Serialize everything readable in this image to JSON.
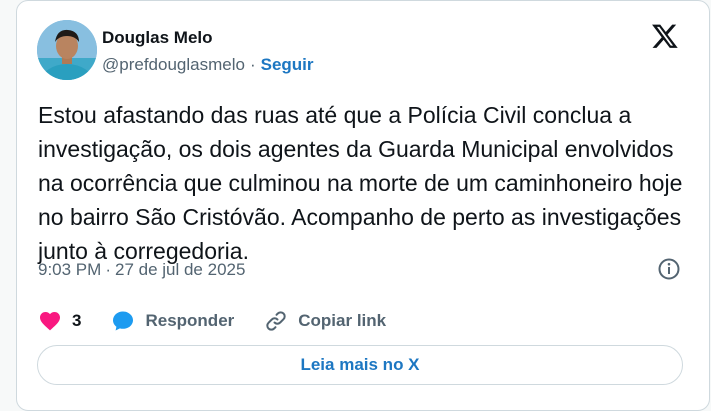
{
  "author": {
    "name": "Douglas Melo",
    "handle": "@prefdouglasmelo",
    "separator": "·",
    "follow_label": "Seguir"
  },
  "tweet": {
    "text": "Estou afastando das ruas até que a Polícia Civil conclua a investigação, os dois agentes da Guarda Municipal envolvidos na ocorrência que culminou na morte de um caminhoneiro hoje no bairro São Cristóvão. Acompanho de perto as investigações junto à corregedoria.",
    "time": "9:03 PM",
    "separator": "·",
    "date": "27 de jul de 2025"
  },
  "actions": {
    "like_count": "3",
    "reply_label": "Responder",
    "copy_label": "Copiar link"
  },
  "read_more_label": "Leia mais no X",
  "icons": {
    "logo": "x-logo-icon",
    "info": "info-icon",
    "like": "heart-icon",
    "reply": "speech-bubble-icon",
    "copy": "link-icon"
  },
  "colors": {
    "accent": "#1d77c2",
    "like": "#f91880",
    "secondary_text": "#536471",
    "border": "#cfd9de"
  }
}
